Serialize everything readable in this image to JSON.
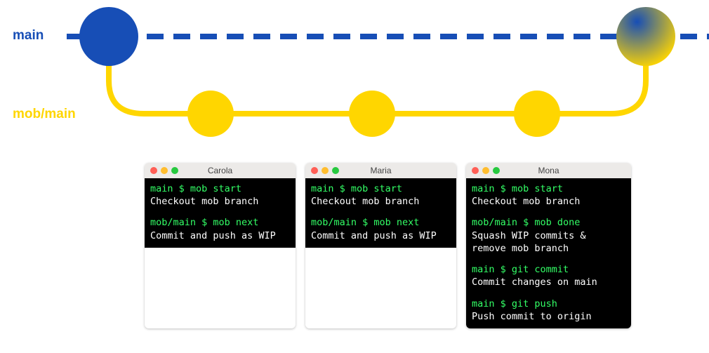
{
  "colors": {
    "blue": "#174eb6",
    "yellow": "#ffd600",
    "green_term": "#33ff66"
  },
  "branches": {
    "main": {
      "label": "main",
      "color": "#174eb6"
    },
    "mob": {
      "label": "mob/main",
      "color": "#ffd600"
    }
  },
  "terminals": [
    {
      "title": "Carola",
      "blocks": [
        {
          "cmd": "main $ mob start",
          "desc": "Checkout mob branch"
        },
        {
          "cmd": "mob/main $ mob next",
          "desc": "Commit and push as WIP"
        }
      ]
    },
    {
      "title": "Maria",
      "blocks": [
        {
          "cmd": "main $ mob start",
          "desc": "Checkout mob branch"
        },
        {
          "cmd": "mob/main $ mob next",
          "desc": "Commit and push as WIP"
        }
      ]
    },
    {
      "title": "Mona",
      "wide": true,
      "blocks": [
        {
          "cmd": "main $ mob start",
          "desc": "Checkout mob branch"
        },
        {
          "cmd": "mob/main $ mob done",
          "desc": "Squash WIP commits & remove mob branch"
        },
        {
          "cmd": "main $ git commit",
          "desc": "Commit changes on main"
        },
        {
          "cmd": "main $ git push",
          "desc": "Push commit to origin"
        }
      ]
    }
  ]
}
